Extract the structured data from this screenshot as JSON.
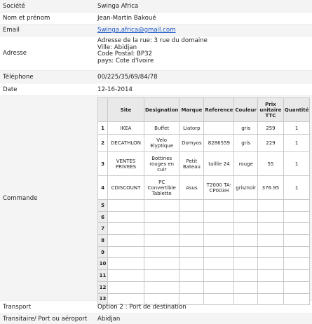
{
  "fields": {
    "societe": {
      "label": "Société",
      "value": "Swinga Africa"
    },
    "nom": {
      "label": "Nom et prénom",
      "value": "Jean-Martin Bakoué"
    },
    "email": {
      "label": "Email",
      "value": "Swinga.africa@gmail.com"
    },
    "adresse": {
      "label": "Adresse",
      "lines": [
        "Adresse de la rue: 3 rue du domaine",
        "Ville: Abidjan",
        "Code Postal: BP32",
        "pays: Cote d'Ivoire"
      ]
    },
    "telephone": {
      "label": "Téléphone",
      "value": "00/225/35/69/84/78"
    },
    "date": {
      "label": "Date",
      "value": "12-16-2014"
    },
    "commande": {
      "label": "Commande"
    },
    "transport": {
      "label": "Transport",
      "value": "Option 2 : Port de destination"
    },
    "transitaire": {
      "label": "Transitaire/ Port ou aéroport",
      "value": "Abidjan"
    }
  },
  "order_table": {
    "headers": [
      "Site",
      "Designation",
      "Marque",
      "Reference",
      "Couleur",
      "Prix unitaire TTC",
      "Quantité"
    ],
    "rows": [
      {
        "n": "1",
        "site": "IKEA",
        "designation": "Buffet",
        "marque": "Liatorp",
        "reference": "",
        "couleur": "gris",
        "prix": "259",
        "quantite": "1"
      },
      {
        "n": "2",
        "site": "DECATHLON",
        "designation": "Velo Elyptique",
        "marque": "Domyos",
        "reference": "8286559",
        "couleur": "gris",
        "prix": "229",
        "quantite": "1"
      },
      {
        "n": "3",
        "site": "VENTES PRIVEES",
        "designation": "Bottines rouges en cuir",
        "marque": "Petit Bateau",
        "reference": "taillie 24",
        "couleur": "rouge",
        "prix": "55",
        "quantite": "1"
      },
      {
        "n": "4",
        "site": "CDISCOUNT",
        "designation": "PC Convertible Tablette",
        "marque": "Asus",
        "reference": "T2000 TA-CP003H",
        "couleur": "gris/noir",
        "prix": "376.95",
        "quantite": "1"
      }
    ],
    "empty_row_numbers": [
      "5",
      "6",
      "7",
      "8",
      "9",
      "10",
      "11",
      "12",
      "13"
    ]
  }
}
